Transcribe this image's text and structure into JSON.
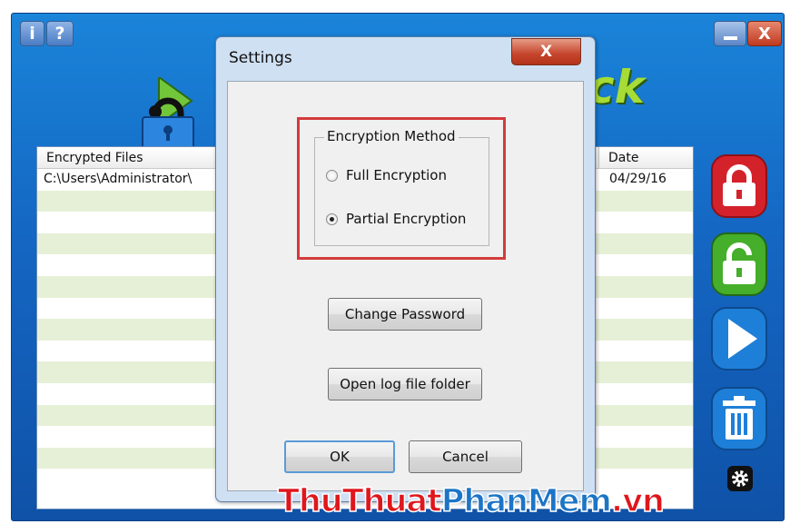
{
  "window": {
    "info_button": "i",
    "help_button": "?",
    "close_button": "X",
    "brand_fragment": "ck"
  },
  "file_list": {
    "columns": [
      "Encrypted Files",
      "Date"
    ],
    "rows": [
      {
        "path": "C:\\Users\\Administrator\\",
        "date": "04/29/16"
      }
    ],
    "row_count": 15
  },
  "dialog": {
    "title": "Settings",
    "close_label": "X",
    "encryption_group": {
      "legend": "Encryption Method",
      "options": [
        "Full Encryption",
        "Partial Encryption"
      ],
      "selected": "Partial Encryption"
    },
    "change_password_label": "Change Password",
    "open_log_label": "Open log file folder",
    "ok_label": "OK",
    "cancel_label": "Cancel"
  },
  "side_buttons": [
    "lock-icon",
    "unlock-icon",
    "play-icon",
    "trash-icon",
    "gear-icon"
  ],
  "colors": {
    "app_blue": "#1466c2",
    "highlight_red": "#d33b3b",
    "row_green": "#e6f0d7",
    "lock_red": "#d4222b",
    "unlock_green": "#45ae2a",
    "play_blue": "#1e7fd8"
  },
  "watermark": {
    "part1": "ThuThuat",
    "part2": "PhanMem",
    "part3": ".vn"
  }
}
